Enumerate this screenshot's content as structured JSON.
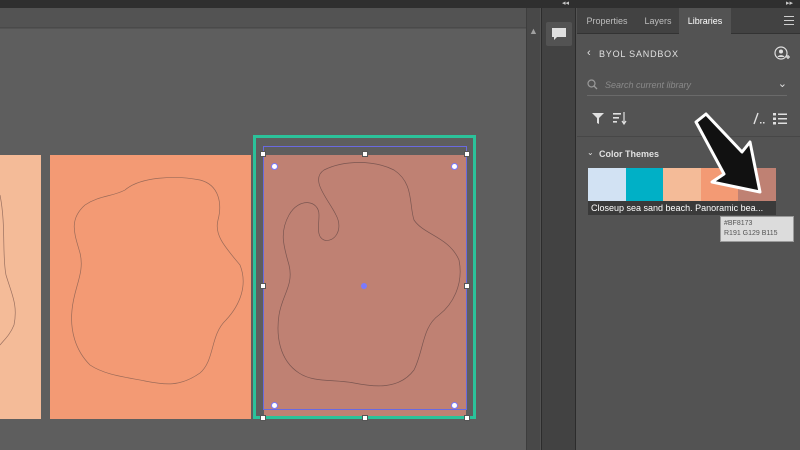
{
  "window": {
    "collapse_left": "◂◂",
    "collapse_right": "▸▸"
  },
  "canvas": {
    "swatch_colors": {
      "light_peach": "#F4BB98",
      "peach": "#F39A74",
      "selected": "#BF8173",
      "outline": "#8a6a60",
      "selection_green": "#2BC29A",
      "bbox_blue": "#6A6AE0"
    }
  },
  "side_strip": {
    "comment_icon": "speech-bubble-icon"
  },
  "panel": {
    "tabs": [
      {
        "label": "Properties",
        "active": false
      },
      {
        "label": "Layers",
        "active": false
      },
      {
        "label": "Libraries",
        "active": true
      }
    ],
    "library_name": "BYOL SANDBOX",
    "search": {
      "placeholder": "Search current library",
      "value": ""
    },
    "toolbar_icons": [
      "filter-icon",
      "sort-icon",
      "pen-icon",
      "list-view-icon"
    ],
    "section": {
      "label": "Color Themes",
      "expanded": true
    },
    "theme": {
      "name": "Closeup sea sand beach. Panoramic bea...",
      "colors": [
        "#D2E2F3",
        "#00B0C6",
        "#F4BB98",
        "#F39A74",
        "#BF8173"
      ]
    },
    "tooltip": {
      "hex": "#BF8173",
      "rgb": "R191 G129 B115"
    }
  }
}
